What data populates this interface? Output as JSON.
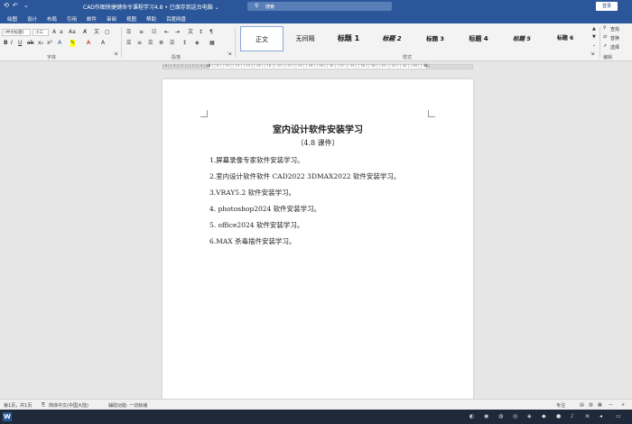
{
  "titlebar": {
    "title": "CAD作图快捷键命令课程学习4.8 • 已保存到这台电脑 ⌄",
    "search_placeholder": "搜索",
    "login_label": "登录"
  },
  "menubar": {
    "items": [
      "绘图",
      "设计",
      "布局",
      "引用",
      "邮件",
      "审阅",
      "视图",
      "帮助",
      "百度网盘"
    ]
  },
  "ribbon": {
    "font_name": "(中文标题)",
    "font_size": "小三",
    "group_font": "字体",
    "group_paragraph": "段落",
    "group_styles": "样式",
    "group_editing": "编辑",
    "styles": [
      "正文",
      "无间隔",
      "标题 1",
      "标题 2",
      "标题 3",
      "标题 4",
      "标题 5",
      "标题 6"
    ],
    "editing": {
      "find": "查找",
      "replace": "替换",
      "select": "选择"
    }
  },
  "ruler": {
    "ticks": "| 6 | | 4 | | 2 | | | 2 | | 4 | | 6 | | 8 | | 10 | | 12 | | 14 | | 16 | | 18 | | 20 | | 22 | | 24 | | 26 | | 28 | | 30 | | 32 | | 34 | | 36 | | 38 | | 40 | | 42 | | 44 | | 46 | | 48 |"
  },
  "document": {
    "heading": "室内设计软件安装学习",
    "subheading": "（4.8 课件）",
    "lines": [
      "1.屏幕录像专家软件安装学习。",
      "2.室内设计软件软件 CAD2022 3DMAX2022 软件安装学习。",
      "3.VRAY5.2 软件安装学习。",
      "4.  photoshop2024 软件安装学习。",
      "5.  office2024 软件安装学习。",
      "6.MAX 杀毒插件安装学习。"
    ]
  },
  "statusbar": {
    "words": "第1页，共1页",
    "language": "简体中文(中国大陆)",
    "accessibility": "辅助功能: 一切就绪",
    "focus": "专注",
    "zoom": "—"
  },
  "colors": {
    "brand": "#2b579a",
    "taskbar": "#1e2a3a"
  }
}
